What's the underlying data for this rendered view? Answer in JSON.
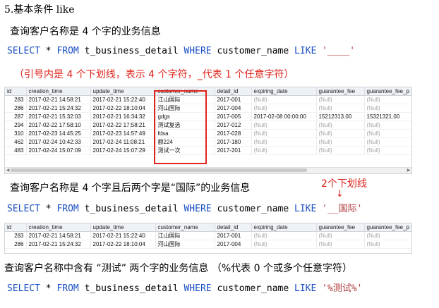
{
  "section_title": "5.基本条件  like",
  "q1": {
    "label": "查询客户名称是 4 个字的业务信息",
    "sql": {
      "k1": "SELECT",
      "p1": " * ",
      "k2": "FROM",
      "p2": " t_business_detail ",
      "k3": "WHERE",
      "p3": " customer_name ",
      "k4": "LIKE",
      "p4": " ",
      "s": "'____'"
    },
    "note": "（引号内是 4 个下划线，表示 4 个字符，_代表 1 个任意字符）"
  },
  "grid1": {
    "columns": [
      "id",
      "creation_time",
      "update_time",
      "customer_name",
      "detail_id",
      "expiring_date",
      "guarantee_fee",
      "guarantee_fee_p"
    ],
    "rows": [
      [
        "283",
        "2017-02-21 14:58:21",
        "2017-02-21 15:22:40",
        "江山国际",
        "2017-001",
        "(Null)",
        "(Null)",
        "(Null)"
      ],
      [
        "286",
        "2017-02-21 15:24:32",
        "2017-02-22 18:10:04",
        "河山国际",
        "2017-004",
        "(Null)",
        "(Null)",
        "(Null)"
      ],
      [
        "287",
        "2017-02-21 15:32:03",
        "2017-02-21 16:34:32",
        "gdgs",
        "2017-005",
        "2017-02-08 00:00:00",
        "15212313.00",
        "15321321.00"
      ],
      [
        "294",
        "2017-02-22 17:58:10",
        "2017-02-22 17:58:21",
        "测试复选",
        "2017-012",
        "(Null)",
        "(Null)",
        "(Null)"
      ],
      [
        "310",
        "2017-02-23 14:45:25",
        "2017-02-23 14:57:49",
        "fdsa",
        "2017-028",
        "(Null)",
        "(Null)",
        "(Null)"
      ],
      [
        "462",
        "2017-02-24 10:42:33",
        "2017-02-24 11:08:21",
        "额224",
        "2017-180",
        "(Null)",
        "(Null)",
        "(Null)"
      ],
      [
        "483",
        "2017-02-24 15:07:09",
        "2017-02-24 15:07:29",
        "测试一次",
        "2017-201",
        "(Null)",
        "(Null)",
        "(Null)"
      ]
    ]
  },
  "q2": {
    "label": "查询客户名称是 4 个字且后两个字是“国际”的业务信息",
    "annotation": "2个下划线",
    "arrow": "↓",
    "sql": {
      "k1": "SELECT",
      "p1": " * ",
      "k2": "FROM",
      "p2": " t_business_detail ",
      "k3": "WHERE",
      "p3": " customer_name ",
      "k4": "LIKE",
      "p4": " ",
      "s": "'__国际'"
    }
  },
  "grid2": {
    "columns": [
      "id",
      "creation_time",
      "update_time",
      "customer_name",
      "detail_id",
      "expiring_date",
      "guarantee_fee",
      "guarantee_fee_p"
    ],
    "rows": [
      [
        "283",
        "2017-02-21 14:58:21",
        "2017-02-21 15:22:40",
        "江山国际",
        "2017-001",
        "(Null)",
        "(Null)",
        "(Null)"
      ],
      [
        "286",
        "2017-02-21 15:24:32",
        "2017-02-22 18:10:04",
        "河山国际",
        "2017-004",
        "(Null)",
        "(Null)",
        "(Null)"
      ]
    ]
  },
  "q3": {
    "label": "查询客户名称中含有 “测试” 两个字的业务信息    （%代表 0 个或多个任意字符）",
    "sql": {
      "k1": "SELECT",
      "p1": " * ",
      "k2": "FROM",
      "p2": " t_business_detail ",
      "k3": "WHERE",
      "p3": " customer_name ",
      "k4": "LIKE",
      "p4": " ",
      "s": "'%测试%'"
    }
  },
  "colors": {
    "keyword": "#1a4fc4",
    "string": "#b03a3a",
    "annotation": "#e0221b"
  }
}
